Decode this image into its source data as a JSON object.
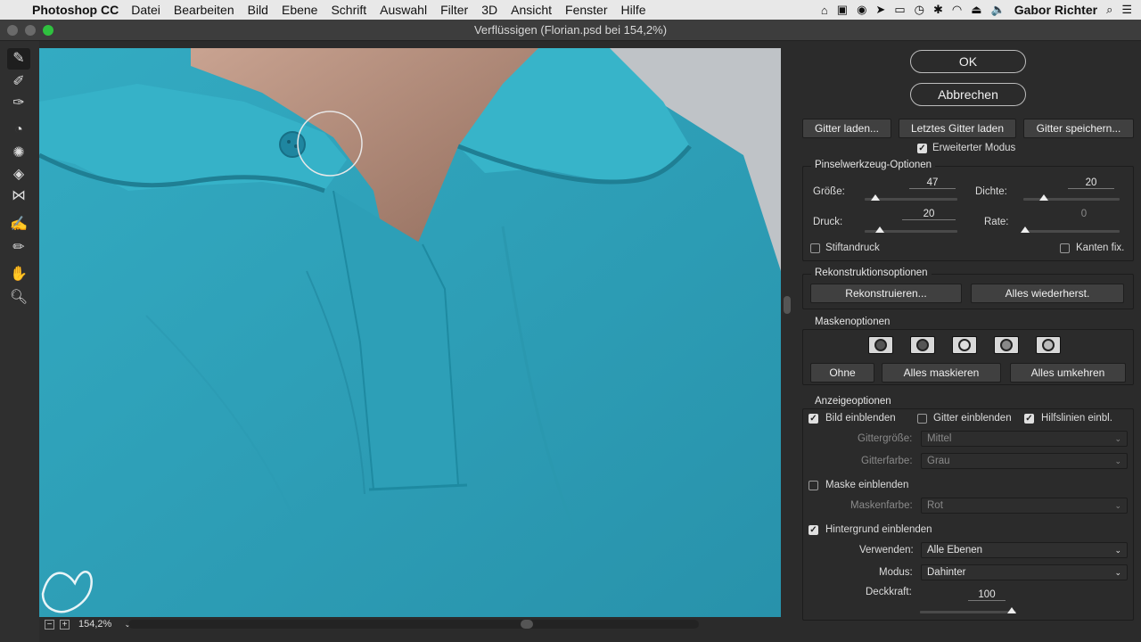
{
  "menubar": {
    "app": "Photoshop CC",
    "menus": [
      "Datei",
      "Bearbeiten",
      "Bild",
      "Ebene",
      "Schrift",
      "Auswahl",
      "Filter",
      "3D",
      "Ansicht",
      "Fenster",
      "Hilfe"
    ],
    "user": "Gabor Richter"
  },
  "window": {
    "title": "Verflüssigen (Florian.psd bei 154,2%)"
  },
  "status": {
    "zoom": "154,2%"
  },
  "panel": {
    "ok": "OK",
    "cancel": "Abbrechen",
    "load_mesh": "Gitter laden...",
    "load_last_mesh": "Letztes Gitter laden",
    "save_mesh": "Gitter speichern...",
    "advanced_mode": "Erweiterter Modus",
    "brush": {
      "title": "Pinselwerkzeug-Optionen",
      "size_label": "Größe:",
      "size": 47,
      "density_label": "Dichte:",
      "density": 20,
      "pressure_label": "Druck:",
      "pressure": 20,
      "rate_label": "Rate:",
      "rate": 0,
      "stylus": "Stiftandruck",
      "pin_edges": "Kanten fix."
    },
    "reconstruct": {
      "title": "Rekonstruktionsoptionen",
      "reconstruct_btn": "Rekonstruieren...",
      "restore_all_btn": "Alles wiederherst."
    },
    "mask": {
      "title": "Maskenoptionen",
      "none": "Ohne",
      "mask_all": "Alles maskieren",
      "invert_all": "Alles umkehren"
    },
    "view": {
      "title": "Anzeigeoptionen",
      "show_image": "Bild einblenden",
      "show_mesh": "Gitter einblenden",
      "show_guides": "Hilfslinien einbl.",
      "mesh_size_label": "Gittergröße:",
      "mesh_size": "Mittel",
      "mesh_color_label": "Gitterfarbe:",
      "mesh_color": "Grau",
      "show_mask": "Maske einblenden",
      "mask_color_label": "Maskenfarbe:",
      "mask_color": "Rot",
      "show_backdrop": "Hintergrund einblenden",
      "use_label": "Verwenden:",
      "use": "Alle Ebenen",
      "mode_label": "Modus:",
      "mode": "Dahinter",
      "opacity_label": "Deckkraft:",
      "opacity": 100
    }
  },
  "icons": {
    "tools": [
      "forward-warp-icon",
      "reconstruct-icon",
      "smooth-icon",
      "twirl-icon",
      "pucker-icon",
      "bloat-icon",
      "push-left-icon",
      "freeze-mask-icon",
      "thaw-mask-icon",
      "hand-icon",
      "zoom-icon"
    ]
  }
}
